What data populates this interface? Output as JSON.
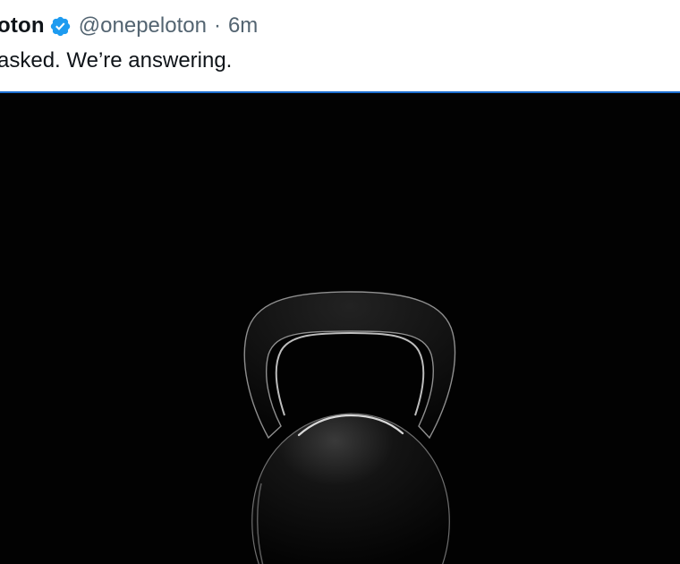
{
  "tweet": {
    "author_name": "oton",
    "verified_icon": "verified-badge-icon",
    "handle": "@onepeloton",
    "separator": "·",
    "timestamp": "6m",
    "text": "asked. We’re answering."
  },
  "media": {
    "image_subject": "kettlebell-image",
    "background_color": "#020202",
    "accent_color": "#1d6fd1"
  },
  "colors": {
    "primary_text": "#0f1419",
    "secondary_text": "#536471",
    "verified_blue": "#1d9bf0"
  }
}
